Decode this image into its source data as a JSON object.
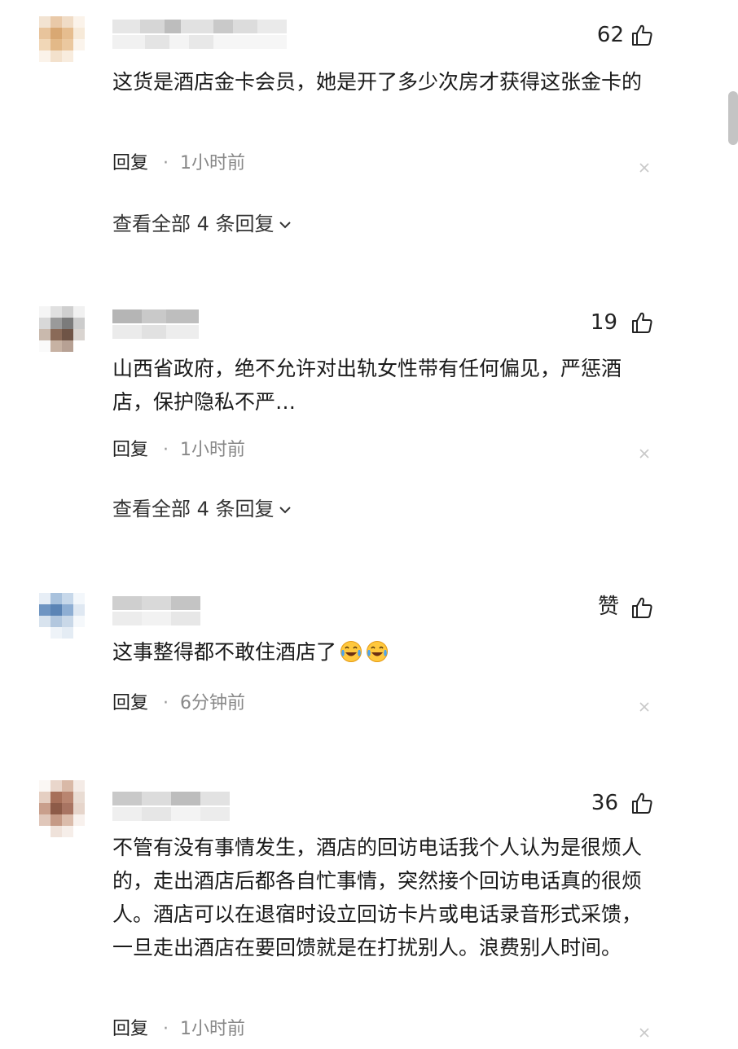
{
  "comments": [
    {
      "likes": "62",
      "content": "这货是酒店金卡会员，她是开了多少次房才获得这张金卡的",
      "reply_label": "回复",
      "separator": "·",
      "time": "1小时前",
      "view_replies": "查看全部 4 条回复"
    },
    {
      "likes": "19",
      "content": "山西省政府，绝不允许对出轨女性带有任何偏见，严惩酒店，保护隐私不严…",
      "reply_label": "回复",
      "separator": "·",
      "time": "1小时前",
      "view_replies": "查看全部 4 条回复"
    },
    {
      "likes": "赞",
      "content": "这事整得都不敢住酒店了",
      "emoji": [
        "laugh-cry-emoji",
        "laugh-cry-emoji"
      ],
      "reply_label": "回复",
      "separator": "·",
      "time": "6分钟前"
    },
    {
      "likes": "36",
      "content": "不管有没有事情发生，酒店的回访电话我个人认为是很烦人的，走出酒店后都各自忙事情，突然接个回访电话真的很烦人。酒店可以在退宿时设立回访卡片或电话录音形式采馈，一旦走出酒店在要回馈就是在打扰别人。浪费别人时间。",
      "reply_label": "回复",
      "separator": "·",
      "time": "1小时前"
    }
  ],
  "icons": {
    "like": "thumbs-up-icon",
    "close": "close-icon",
    "expand": "chevron-down-icon"
  },
  "colors": {
    "text": "#1a1a1a",
    "meta": "#888888",
    "background": "#ffffff"
  }
}
